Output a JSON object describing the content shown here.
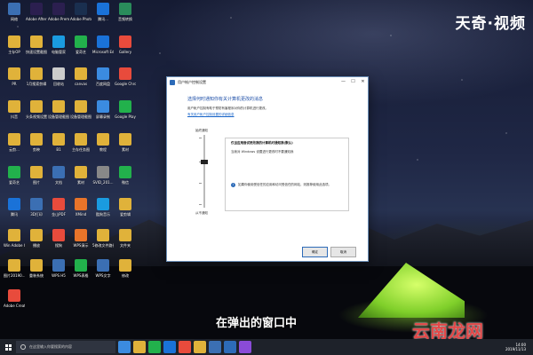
{
  "brand": "天奇·视频",
  "subtitle": "在弹出的窗口中",
  "watermark": "云南龙网",
  "desktop_icons": [
    {
      "label": "网络",
      "color": "#3b6fb3"
    },
    {
      "label": "Adobe After Effects CC",
      "color": "#2b1f4f"
    },
    {
      "label": "Adobe Premiere P...",
      "color": "#2b1f4f"
    },
    {
      "label": "Adobe Photoshop...",
      "color": "#1a2f4f"
    },
    {
      "label": "腾讯...",
      "color": "#1a72d8"
    },
    {
      "label": "音频转换",
      "color": "#2a8c5b"
    },
    {
      "label": "主存OP",
      "color": "#e0b23a"
    },
    {
      "label": "快速设置截图",
      "color": "#e0b23a"
    },
    {
      "label": "电脑管家",
      "color": "#1a9be0"
    },
    {
      "label": "爱奇艺",
      "color": "#22b14c"
    },
    {
      "label": "Microsoft Edge",
      "color": "#1a72d8"
    },
    {
      "label": "Gallery",
      "color": "#e84b3c"
    },
    {
      "label": "PR",
      "color": "#e0b23a"
    },
    {
      "label": "1月搜索剪辑",
      "color": "#e0b23a"
    },
    {
      "label": "回收站",
      "color": "#ccc"
    },
    {
      "label": "canvas",
      "color": "#e0b23a"
    },
    {
      "label": "百度网盘",
      "color": "#3b8be0"
    },
    {
      "label": "Google Chrome",
      "color": "#e84b3c"
    },
    {
      "label": "抖音",
      "color": "#e0b23a"
    },
    {
      "label": "头条视频设置截图",
      "color": "#e0b23a"
    },
    {
      "label": "设备管理截图",
      "color": "#e0b23a"
    },
    {
      "label": "设备管理截图",
      "color": "#e0b23a"
    },
    {
      "label": "屏幕录制",
      "color": "#3b8be0"
    },
    {
      "label": "Google Play",
      "color": "#22b14c"
    },
    {
      "label": "云剪...",
      "color": "#e0b23a"
    },
    {
      "label": "剪映",
      "color": "#e0b23a"
    },
    {
      "label": "B1",
      "color": "#e0b23a"
    },
    {
      "label": "主存任务图",
      "color": "#e0b23a"
    },
    {
      "label": "教程",
      "color": "#e0b23a"
    },
    {
      "label": "素材",
      "color": "#e0b23a"
    },
    {
      "label": "爱奇艺",
      "color": "#22b14c"
    },
    {
      "label": "图片",
      "color": "#e0b23a"
    },
    {
      "label": "文档",
      "color": "#3b6fb3"
    },
    {
      "label": "素材",
      "color": "#e0b23a"
    },
    {
      "label": "SVID_201...",
      "color": "#888"
    },
    {
      "label": "微信",
      "color": "#22b14c"
    },
    {
      "label": "腾讯",
      "color": "#1a72d8"
    },
    {
      "label": "3D打印",
      "color": "#3b6fb3"
    },
    {
      "label": "金山PDF",
      "color": "#e84b3c"
    },
    {
      "label": "XMind",
      "color": "#e8742a"
    },
    {
      "label": "酷狗音乐",
      "color": "#1a9be0"
    },
    {
      "label": "爱剪辑",
      "color": "#e0b23a"
    },
    {
      "label": "Win Adobe CC 2018",
      "color": "#e0b23a"
    },
    {
      "label": "播放",
      "color": "#e0b23a"
    },
    {
      "label": "搜狗",
      "color": "#e84b3c"
    },
    {
      "label": "WPS演示",
      "color": "#e8742a"
    },
    {
      "label": "5修改文件路径",
      "color": "#e0b23a"
    },
    {
      "label": "文件夹",
      "color": "#e0b23a"
    },
    {
      "label": "图片20190...",
      "color": "#e0b23a"
    },
    {
      "label": "重装系统",
      "color": "#e0b23a"
    },
    {
      "label": "WPS H5",
      "color": "#3b6fb3"
    },
    {
      "label": "WPS表格",
      "color": "#22b14c"
    },
    {
      "label": "WPS文字",
      "color": "#3b6fb3"
    },
    {
      "label": "修改",
      "color": "#e0b23a"
    },
    {
      "label": "Adobe Creati...",
      "color": "#e84b3c"
    }
  ],
  "dialog": {
    "title": "用户帐户控制设置",
    "heading": "选择何时通知你有关计算机更改的消息",
    "description": "用户帐户控制有助于预防有害程序对你的计算机进行更改。",
    "link": "有关用户帐户控制设置的详细信息",
    "level_top": "始终通知",
    "level_bottom": "从不通知",
    "box_heading": "仅当应用尝试更改我的计算机时通知我(默认)",
    "box_item": "当我对 Windows 设置进行更改时不要通知我",
    "box_note": "如果你使用受信任的应用和访问受信任的网站，则推荐使用此选项。",
    "ok": "确定",
    "cancel": "取消"
  },
  "taskbar": {
    "search_placeholder": "在这里输入你要搜索的内容",
    "apps": [
      "#3b8be0",
      "#e0b23a",
      "#22b14c",
      "#1a72d8",
      "#e84b3c",
      "#e0b23a",
      "#3b6fb3",
      "#2d6bb8",
      "#8a4bd8"
    ],
    "time": "14:00",
    "date": "2019/11/13"
  }
}
